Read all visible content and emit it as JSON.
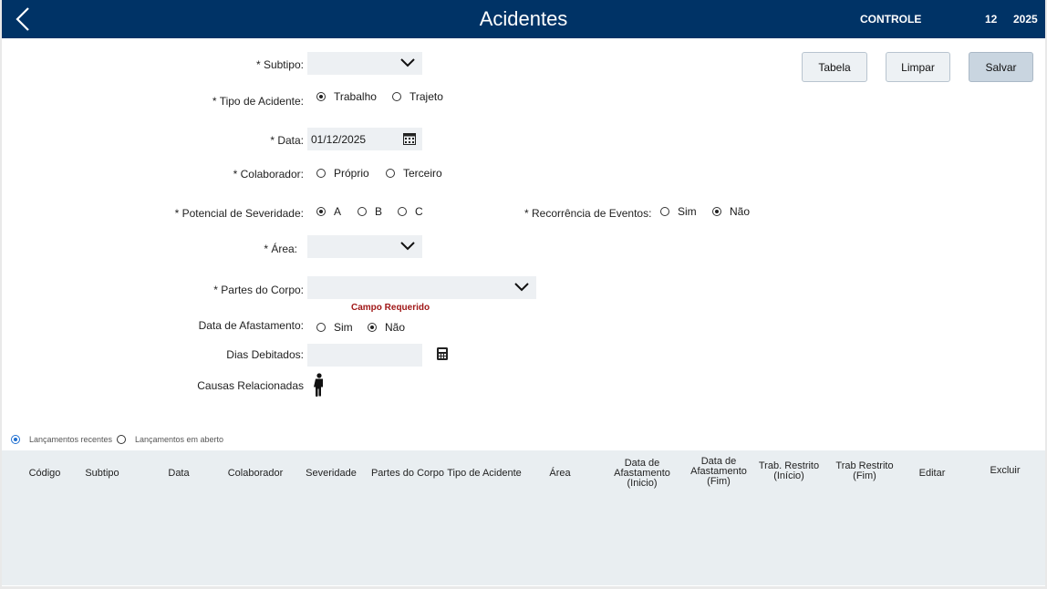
{
  "header": {
    "title": "Acidentes",
    "control_label": "CONTROLE",
    "month": "12",
    "year": "2025",
    "bg_color": "#003366"
  },
  "buttons": {
    "tabela": "Tabela",
    "limpar": "Limpar",
    "salvar": "Salvar"
  },
  "form": {
    "subtipo": {
      "label": "* Subtipo:",
      "value": ""
    },
    "tipo_acidente": {
      "label": "* Tipo de Acidente:",
      "options": [
        "Trabalho",
        "Trajeto"
      ],
      "selected": "Trabalho"
    },
    "data": {
      "label": "* Data:",
      "value": "01/12/2025"
    },
    "colaborador": {
      "label": "* Colaborador:",
      "options": [
        "Próprio",
        "Terceiro"
      ],
      "selected": ""
    },
    "potencial_severidade": {
      "label": "* Potencial de Severidade:",
      "options": [
        "A",
        "B",
        "C"
      ],
      "selected": "A"
    },
    "recorrencia": {
      "label": "* Recorrência de Eventos:",
      "options": [
        "Sim",
        "Não"
      ],
      "selected": "Não"
    },
    "area": {
      "label": "* Área:",
      "value": ""
    },
    "partes_corpo": {
      "label": "* Partes do Corpo:",
      "value": "",
      "error": "Campo Requerido"
    },
    "data_afastamento": {
      "label": "Data de Afastamento:",
      "options": [
        "Sim",
        "Não"
      ],
      "selected": "Não"
    },
    "dias_debitados": {
      "label": "Dias Debitados:",
      "value": ""
    },
    "causas": {
      "label": "Causas Relacionadas"
    }
  },
  "list_filter": {
    "options": [
      "Lançamentos recentes",
      "Lançamentos em aberto"
    ],
    "selected": "Lançamentos recentes"
  },
  "table": {
    "columns": [
      "Código",
      "Subtipo",
      "Data",
      "Colaborador",
      "Severidade",
      "Partes do Corpo",
      "Tipo de Acidente",
      "Área",
      "Data de\nAfastamento\n(Inicio)",
      "Data de\nAfastamento\n(Fim)",
      "Trab. Restrito\n(Início)",
      "Trab Restrito\n(Fim)",
      "Editar",
      "Excluir"
    ],
    "rows": []
  }
}
